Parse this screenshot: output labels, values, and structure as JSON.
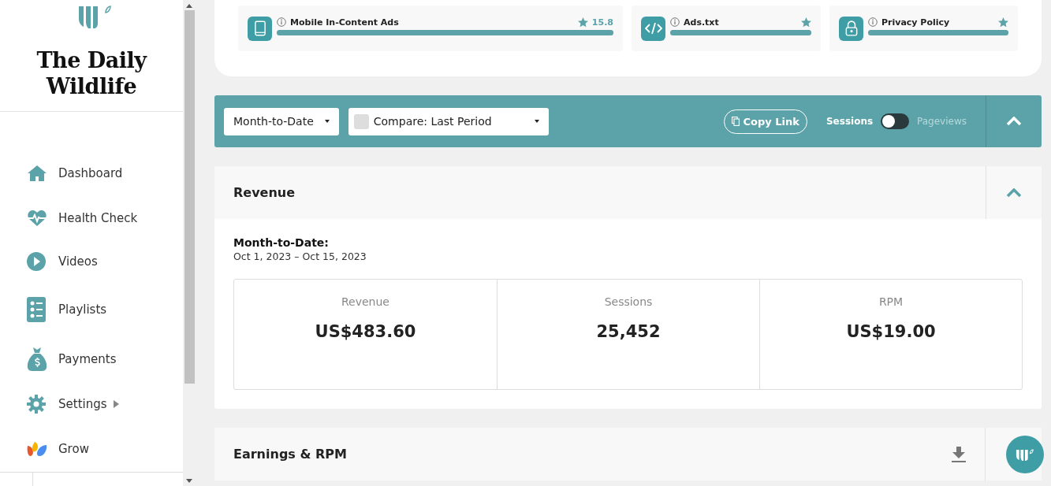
{
  "sidebar": {
    "site_title": "The Daily Wildlife",
    "items": [
      {
        "label": "Dashboard",
        "has_submenu": false
      },
      {
        "label": "Health Check",
        "has_submenu": false
      },
      {
        "label": "Videos",
        "has_submenu": false
      },
      {
        "label": "Playlists",
        "has_submenu": false
      },
      {
        "label": "Payments",
        "has_submenu": false
      },
      {
        "label": "Settings",
        "has_submenu": true
      },
      {
        "label": "Grow",
        "has_submenu": false
      }
    ]
  },
  "health_checks": [
    {
      "label": "Mobile In-Content Ads",
      "level": 1,
      "score": "15.8"
    },
    {
      "label": "Ads.txt",
      "level": 1
    },
    {
      "label": "Privacy Policy",
      "level": 1
    }
  ],
  "toolbar": {
    "date_range": "Month-to-Date",
    "compare": "Compare: Last Period",
    "copy_link": "Copy Link",
    "toggle": {
      "left_label": "Sessions",
      "right_label": "Pageviews",
      "on": false
    }
  },
  "revenue": {
    "title": "Revenue",
    "period_label": "Month-to-Date:",
    "period_dates": "Oct 1, 2023 – Oct 15, 2023",
    "metrics": [
      {
        "label": "Revenue",
        "value": "US$483.60"
      },
      {
        "label": "Sessions",
        "value": "25,452"
      },
      {
        "label": "RPM",
        "value": "US$19.00"
      }
    ]
  },
  "earnings": {
    "title": "Earnings & RPM"
  }
}
